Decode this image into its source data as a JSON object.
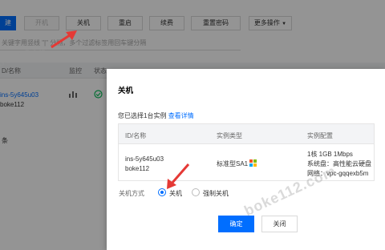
{
  "toolbar": {
    "primary_label": "建",
    "start": "开机",
    "shutdown": "关机",
    "restart": "重启",
    "renew": "续费",
    "reset_password": "重置密码",
    "more": "更多操作"
  },
  "search": {
    "placeholder": "关键字用竖线 \"|\" 分隔，多个过滤标签用回车键分隔"
  },
  "table": {
    "headers": [
      "D/名称",
      "监控",
      "状态"
    ],
    "row": {
      "id": "ins-5y645u03",
      "name": "boke112"
    },
    "footer": "条"
  },
  "dialog": {
    "title": "关机",
    "selected_prefix": "您已选择1台实例",
    "view_details": "查看详情",
    "col_id": "ID/名称",
    "col_type": "实例类型",
    "col_config": "实例配置",
    "instance_id": "ins-5y645u03",
    "instance_name": "boke112",
    "instance_type": "标准型SA1",
    "config_line1": "1核 1GB 1Mbps",
    "config_line2": "系统盘：高性能云硬盘",
    "config_line3": "网络：vpc-gqqexb5m",
    "mode_label": "关机方式",
    "option_shutdown": "关机",
    "option_force": "强制关机",
    "confirm": "确定",
    "close": "关闭"
  },
  "watermark": "boke112.com",
  "colors": {
    "accent": "#006eff",
    "arrow": "#e53935"
  }
}
